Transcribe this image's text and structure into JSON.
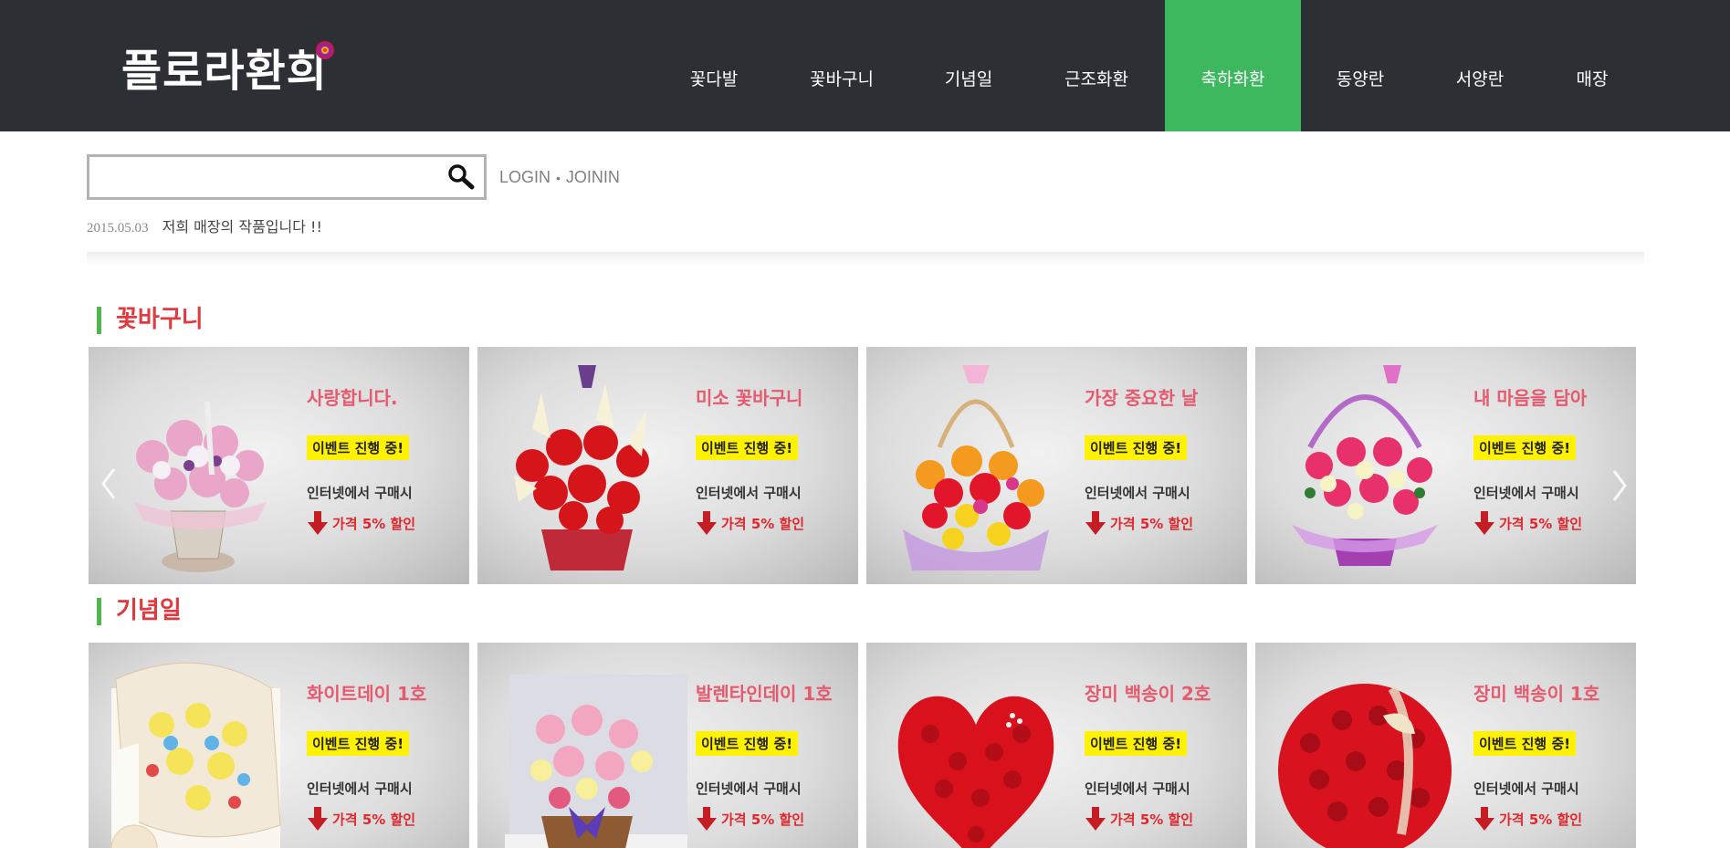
{
  "brand": {
    "logo_text": "플로라환희"
  },
  "nav": {
    "items": [
      {
        "label": "꽃다발"
      },
      {
        "label": "꽃바구니"
      },
      {
        "label": "기념일"
      },
      {
        "label": "근조화환"
      },
      {
        "label": "축하화환",
        "active": true
      },
      {
        "label": "동양란"
      },
      {
        "label": "서양란"
      },
      {
        "label": "매장"
      }
    ]
  },
  "search": {
    "value": "",
    "placeholder": "",
    "icon": "search-icon"
  },
  "account": {
    "login_label": "LOGIN",
    "separator": "•",
    "join_label": "JOININ"
  },
  "notice": {
    "date": "2015.05.03",
    "text": "저희 매장의 작품입니다 !!"
  },
  "colors": {
    "header_bg": "#2c3035",
    "active_nav": "#3db85e",
    "section_title": "#e0393e",
    "section_bar": "#4cb84c",
    "card_title": "#e55a6e",
    "badge": "#fff200",
    "discount": "#e0272d"
  },
  "sections": [
    {
      "title": "꽃바구니",
      "cards": [
        {
          "title": "사랑합니다.",
          "badge": "이벤트 진행 중!",
          "line1": "인터넷에서 구매시",
          "line2": "가격 5% 할인",
          "flower": "mixed-pink-white"
        },
        {
          "title": "미소 꽃바구니",
          "badge": "이벤트 진행 중!",
          "line1": "인터넷에서 구매시",
          "line2": "가격 5% 할인",
          "flower": "red-carnation-lily"
        },
        {
          "title": "가장 중요한 날",
          "badge": "이벤트 진행 중!",
          "line1": "인터넷에서 구매시",
          "line2": "가격 5% 할인",
          "flower": "orange-red-mixed"
        },
        {
          "title": "내 마음을 담아",
          "badge": "이벤트 진행 중!",
          "line1": "인터넷에서 구매시",
          "line2": "가격 5% 할인",
          "flower": "pink-rose-basket"
        }
      ]
    },
    {
      "title": "기념일",
      "cards": [
        {
          "title": "화이트데이 1호",
          "badge": "이벤트 진행 중!",
          "line1": "인터넷에서 구매시",
          "line2": "가격 5% 할인",
          "flower": "candy-heart-box"
        },
        {
          "title": "발렌타인데이 1호",
          "badge": "이벤트 진행 중!",
          "line1": "인터넷에서 구매시",
          "line2": "가격 5% 할인",
          "flower": "pastel-rose-basket"
        },
        {
          "title": "장미 백송이 2호",
          "badge": "이벤트 진행 중!",
          "line1": "인터넷에서 구매시",
          "line2": "가격 5% 할인",
          "flower": "red-rose-heart"
        },
        {
          "title": "장미 백송이 1호",
          "badge": "이벤트 진행 중!",
          "line1": "인터넷에서 구매시",
          "line2": "가격 5% 할인",
          "flower": "red-rose-basket"
        }
      ]
    }
  ]
}
